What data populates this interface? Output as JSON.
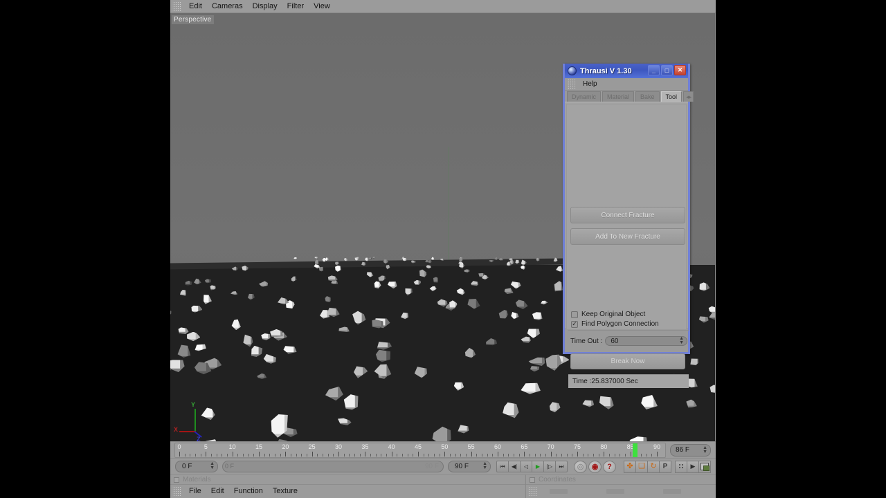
{
  "menubar": {
    "items": [
      "Edit",
      "Cameras",
      "Display",
      "Filter",
      "View"
    ]
  },
  "viewport": {
    "label": "Perspective",
    "gizmo": {
      "x": "X",
      "y": "Y",
      "z": "Z"
    }
  },
  "timeline": {
    "ticks": [
      0,
      5,
      10,
      15,
      20,
      25,
      30,
      35,
      40,
      45,
      50,
      55,
      60,
      65,
      70,
      75,
      80,
      85,
      90
    ],
    "playhead_frame": 86,
    "min_frame": 0,
    "max_frame": 90,
    "current_frame_field": "86 F",
    "start_field": "0 F",
    "end_field": "90 F",
    "slider_left_label": "0 F",
    "slider_right_label": "90 F"
  },
  "transport": {
    "buttons": [
      {
        "name": "go-to-start",
        "glyph": "⏮"
      },
      {
        "name": "previous-key",
        "glyph": "◀|"
      },
      {
        "name": "step-back",
        "glyph": "◁"
      },
      {
        "name": "play",
        "glyph": "▶"
      },
      {
        "name": "step-forward",
        "glyph": "|▷"
      },
      {
        "name": "go-to-end",
        "glyph": "⏭"
      }
    ],
    "record_buttons": [
      {
        "name": "autokey-toggle",
        "glyph": "◎",
        "dim": true
      },
      {
        "name": "record-active-objects",
        "glyph": "◉",
        "dim": false
      },
      {
        "name": "record-help",
        "glyph": "?",
        "dim": false
      }
    ],
    "tool_icons": [
      {
        "name": "move-tool-icon",
        "glyph": "✤"
      },
      {
        "name": "scale-tool-icon",
        "glyph": "❑"
      },
      {
        "name": "rotate-tool-icon",
        "glyph": "↻"
      },
      {
        "name": "parametric-tool-icon",
        "glyph": "P"
      }
    ]
  },
  "materials_panel": {
    "title": "Materials",
    "menu": [
      "File",
      "Edit",
      "Function",
      "Texture"
    ]
  },
  "coordinates_panel": {
    "title": "Coordinates"
  },
  "thrausi": {
    "title": "Thrausi V 1.30",
    "window_buttons": {
      "minimize": "_",
      "maximize": "□",
      "close": "✕"
    },
    "menu": [
      "Help"
    ],
    "tabs": [
      {
        "label": "Dynamic",
        "active": false
      },
      {
        "label": "Material",
        "active": false
      },
      {
        "label": "Bake",
        "active": false
      },
      {
        "label": "Tool",
        "active": true
      }
    ],
    "tabs_scroll_label": "◂▸",
    "buttons": {
      "connect_fracture": "Connect Fracture",
      "add_to_new_fracture": "Add To New Fracture",
      "break_now": "Break Now"
    },
    "checkboxes": [
      {
        "label": "Keep Original Object",
        "checked": false
      },
      {
        "label": "Find Polygon Connection",
        "checked": true
      }
    ],
    "timeout": {
      "label": "Time Out :",
      "value": "60"
    },
    "status": "Time :25.837000 Sec"
  },
  "colors": {
    "titlebar_blue": "#3d57c0",
    "window_border": "#6f7fd6",
    "playhead_green": "#3ee03e",
    "ui_gray": "#9b9b9b",
    "viewport_gray": "#6e6e6e",
    "floor_dark": "#212121",
    "accent_orange": "#c86a18",
    "record_red": "#a11515"
  }
}
